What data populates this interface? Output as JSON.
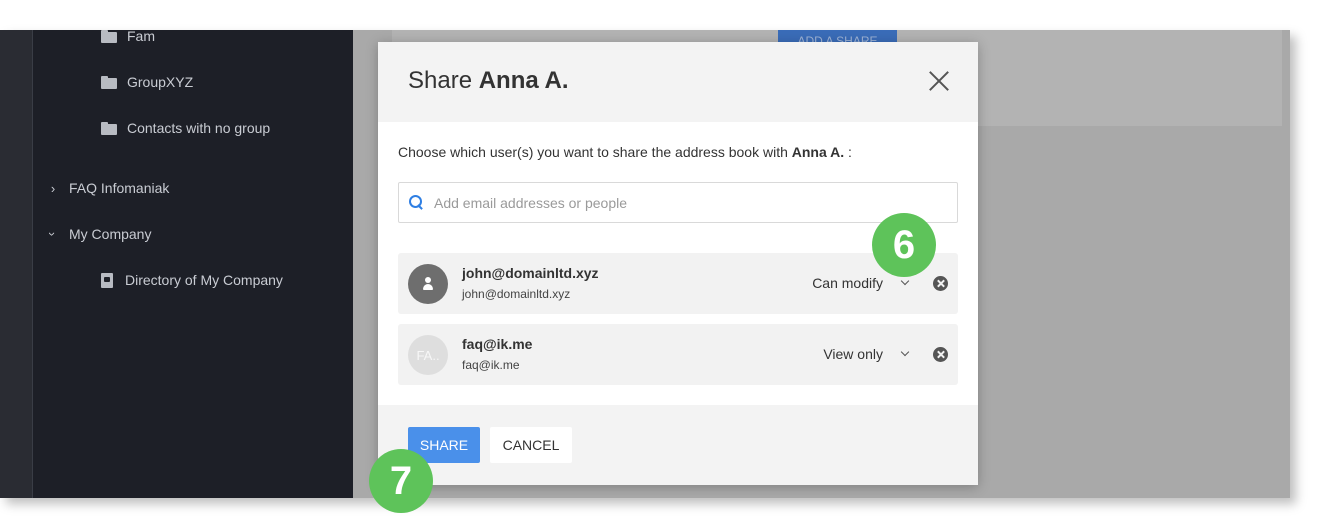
{
  "sidebar": {
    "folders": [
      {
        "label": "Fam"
      },
      {
        "label": "GroupXYZ"
      },
      {
        "label": "Contacts with no group"
      }
    ],
    "groups": [
      {
        "label": "FAQ Infomaniak",
        "expanded": false
      },
      {
        "label": "My Company",
        "expanded": true
      }
    ],
    "directory": {
      "label": "Directory of My Company"
    }
  },
  "background": {
    "add_share_label": "ADD A SHARE"
  },
  "modal": {
    "title_prefix": "Share",
    "title_name": "Anna A.",
    "instruction_text": "Choose which user(s) you want to share the address book with",
    "instruction_name": "Anna A.",
    "instruction_suffix": " :",
    "search_placeholder": "Add email addresses or people",
    "users": [
      {
        "name": "john@domainltd.xyz",
        "email": "john@domainltd.xyz",
        "permission": "Can modify",
        "avatar": "person-icon"
      },
      {
        "name": "faq@ik.me",
        "email": "faq@ik.me",
        "permission": "View only",
        "avatar_initials": "FA.."
      }
    ],
    "share_label": "SHARE",
    "cancel_label": "CANCEL"
  },
  "markers": {
    "step_6": "6",
    "step_7": "7"
  },
  "colors": {
    "accent": "#4a90ea",
    "marker": "#5ec35a",
    "sidebar": "#1d1f27"
  }
}
